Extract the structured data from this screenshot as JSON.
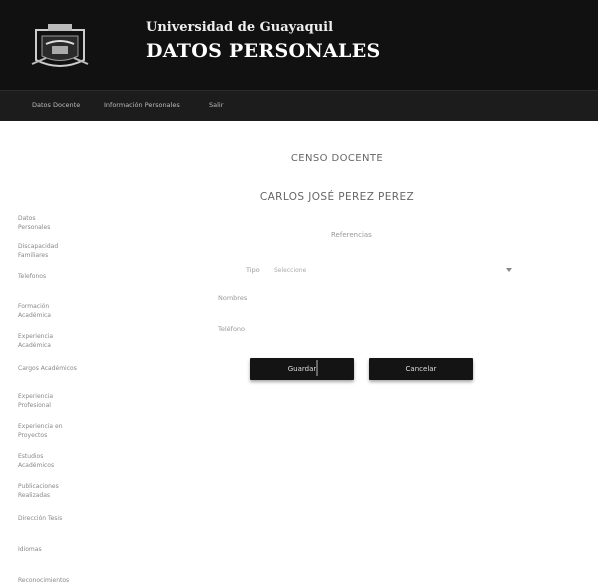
{
  "header": {
    "university": "Universidad de Guayaquil",
    "page_title": "DATOS PERSONALES"
  },
  "nav": {
    "items": [
      "Datos Docente",
      "Información Personales",
      "Salir"
    ]
  },
  "main": {
    "census_title": "CENSO DOCENTE",
    "teacher_name": "CARLOS JOSÉ PEREZ PEREZ",
    "section_title": "Referencias",
    "fields": {
      "tipo_label": "Tipo",
      "tipo_value": "Seleccione",
      "nombres_label": "Nombres",
      "telefono_label": "Teléfono"
    },
    "buttons": {
      "save": "Guardar",
      "cancel": "Cancelar"
    }
  },
  "sidebar": {
    "items": [
      [
        "Datos",
        "Personales"
      ],
      [
        "Discapacidad",
        "Familiares"
      ],
      [
        "Telefonos"
      ],
      [
        "Formación",
        "Académica"
      ],
      [
        "Experiencia",
        "Académica"
      ],
      [
        "Cargos Académicos"
      ],
      [
        "Experiencia",
        "Profesional"
      ],
      [
        "Experiencia en",
        "Proyectos"
      ],
      [
        "Estudios",
        "Académicos"
      ],
      [
        "Publicaciones",
        "Realizadas"
      ],
      [
        "Dirección Tesis"
      ],
      [
        "Idiomas"
      ],
      [
        "Reconocimientos"
      ]
    ]
  },
  "colors": {
    "header_bg": "#111111",
    "nav_bg": "#1c1c1c",
    "button_bg": "#141414"
  }
}
